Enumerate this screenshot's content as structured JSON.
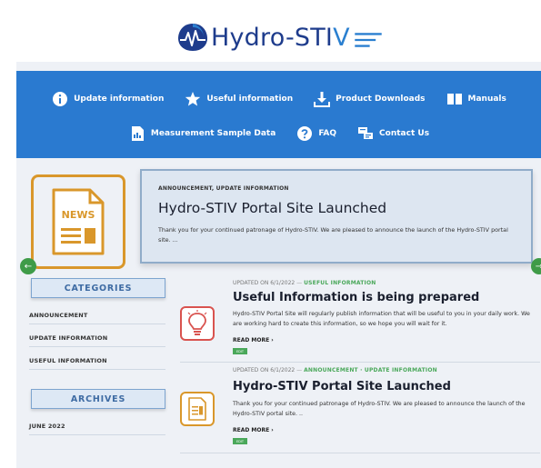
{
  "brand": {
    "name_main": "Hydro-STI",
    "name_v": "V"
  },
  "nav": {
    "row1": [
      {
        "label": "Update information",
        "icon": "info-icon"
      },
      {
        "label": "Useful information",
        "icon": "star-icon"
      },
      {
        "label": "Product Downloads",
        "icon": "download-icon"
      },
      {
        "label": "Manuals",
        "icon": "book-icon"
      }
    ],
    "row2": [
      {
        "label": "Measurement Sample Data",
        "icon": "data-file-icon"
      },
      {
        "label": "FAQ",
        "icon": "question-icon"
      },
      {
        "label": "Contact Us",
        "icon": "contact-icon"
      }
    ]
  },
  "featured": {
    "icon_label": "NEWS",
    "categories": "ANNOUNCEMENT, UPDATE INFORMATION",
    "title": "Hydro-STIV Portal Site Launched",
    "excerpt": "Thank you for your continued patronage of Hydro-STIV. We are pleased to announce the launch of the Hydro-STIV portal site. ..."
  },
  "sidebar": {
    "categories_heading": "CATEGORIES",
    "categories": [
      "ANNOUNCEMENT",
      "UPDATE INFORMATION",
      "USEFUL INFORMATION"
    ],
    "archives_heading": "ARCHIVES",
    "archives": [
      "JUNE 2022"
    ]
  },
  "posts": [
    {
      "date": "UPDATED ON 6/1/2022",
      "separator": "—",
      "categories": "USEFUL INFORMATION",
      "title": "Useful Information is being prepared",
      "excerpt": "Hydro-STIV Portal Site will regularly publish information that will be useful to you in your daily work. We are working hard to create this information, so we hope you will wait for it.",
      "read_more": "READ MORE ›",
      "tag": "EDIT"
    },
    {
      "date": "UPDATED ON 6/1/2022",
      "separator": "—",
      "categories": "ANNOUNCEMENT · UPDATE INFORMATION",
      "title": "Hydro-STIV Portal Site Launched",
      "excerpt": "Thank you for your continued patronage of Hydro-STIV. We are pleased to announce the launch of the Hydro-STIV portal site. ..",
      "read_more": "READ MORE ›",
      "tag": "EDIT"
    }
  ],
  "controls": {
    "prev_arrow": "←",
    "next_arrow": "→"
  },
  "colors": {
    "nav_bg": "#2a7ad0",
    "brand_navy": "#1e3c8c",
    "accent_orange": "#d9972b",
    "accent_green": "#4aa85a",
    "accent_red": "#d9534f"
  }
}
